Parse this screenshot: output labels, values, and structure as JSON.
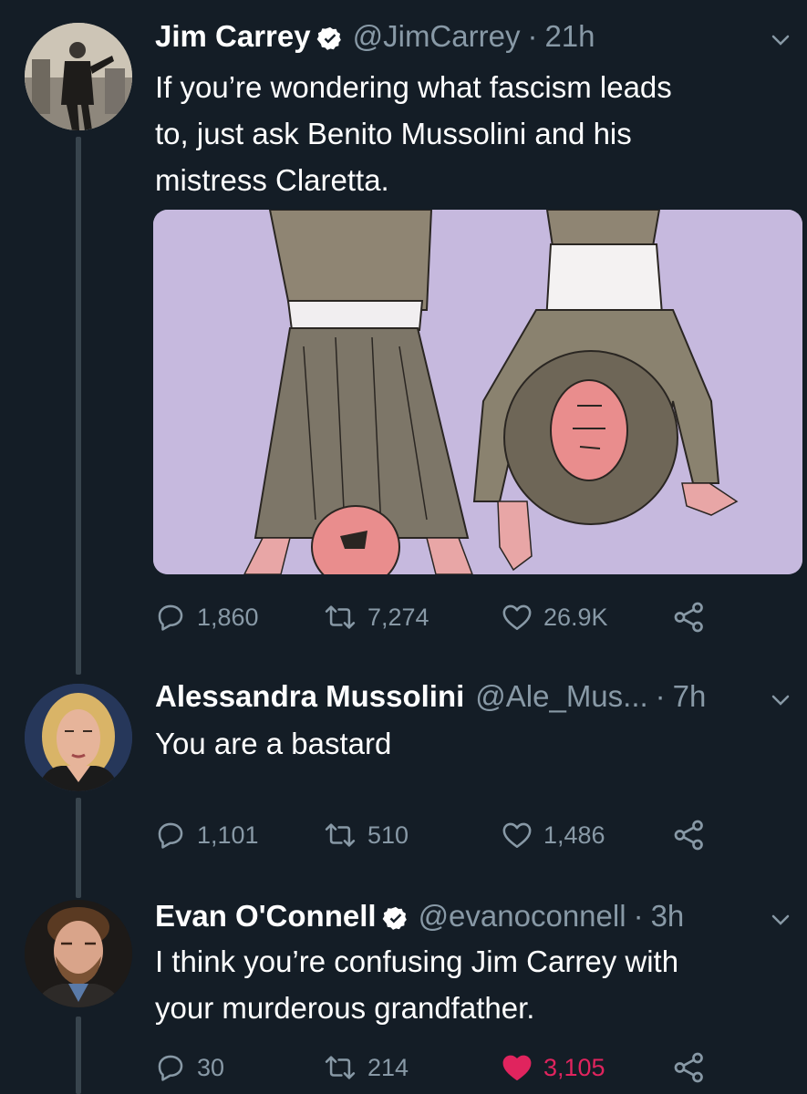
{
  "tweets": [
    {
      "name": "Jim Carrey",
      "verified": true,
      "handle": "@JimCarrey",
      "separator": "·",
      "time": "21h",
      "text_lines": [
        "If you’re wondering what fascism leads",
        "to, just ask Benito Mussolini and his",
        "mistress Claretta."
      ],
      "has_media": true,
      "replies": "1,860",
      "retweets": "7,274",
      "likes": "26.9K",
      "liked": false
    },
    {
      "name": "Alessandra Mussolini",
      "verified": false,
      "handle": "@Ale_Mus...",
      "separator": "·",
      "time": "7h",
      "text_lines": [
        "You are a bastard"
      ],
      "has_media": false,
      "replies": "1,101",
      "retweets": "510",
      "likes": "1,486",
      "liked": false
    },
    {
      "name": "Evan O'Connell",
      "verified": true,
      "handle": "@evanoconnell",
      "separator": "·",
      "time": "3h",
      "text_lines": [
        "I think you’re confusing Jim Carrey with",
        "your murderous grandfather."
      ],
      "has_media": false,
      "replies": "30",
      "retweets": "214",
      "likes": "3,105",
      "liked": true
    }
  ],
  "colors": {
    "background": "#141d26",
    "secondary_text": "#8899a6",
    "verified": "#ffffff",
    "like_active": "#e0245e",
    "media_background": "#c6b9de",
    "thread_line": "#38444d"
  },
  "icons": [
    "verified-badge-icon",
    "chevron-down-icon",
    "reply-icon",
    "retweet-icon",
    "like-icon",
    "share-icon"
  ]
}
